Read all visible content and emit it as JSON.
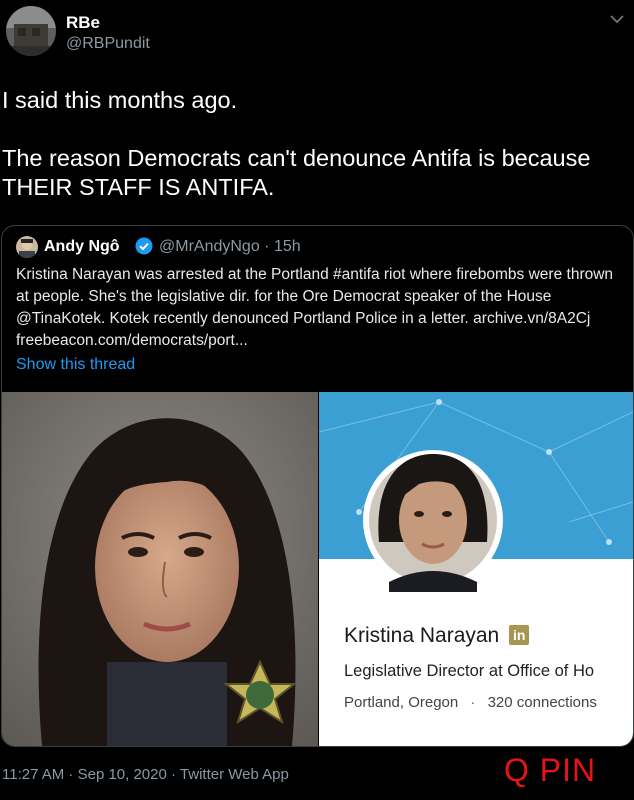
{
  "tweet": {
    "author_name": "RBe",
    "author_handle": "@RBPundit",
    "text": "I said this months ago.\n\nThe reason Democrats can't denounce Antifa is because THEIR STAFF IS ANTIFA.",
    "footer": "11:27 AM · Sep 10, 2020 · Twitter Web App"
  },
  "quoted": {
    "author_name": "Andy Ngô",
    "meta": "@MrAndyNgo · 15h",
    "text": "Kristina Narayan was arrested at the Portland #antifa riot where firebombs were thrown at people. She's the legislative dir. for the Ore Democrat speaker of the House @TinaKotek. Kotek recently denounced Portland Police in a letter. archive.vn/8A2Cj freebeacon.com/democrats/port...",
    "show_thread": "Show this thread"
  },
  "linkedin_card": {
    "name": "Kristina Narayan",
    "badge": "in",
    "title": "Legislative Director at Office of Ho",
    "location": "Portland, Oregon",
    "connections": "320 connections"
  },
  "watermark": "Q PIN",
  "colors": {
    "link": "#1d9bf0",
    "watermark": "#e81414",
    "verified": "#1d9bf0",
    "linkedin_bg": "#3b9fd4"
  },
  "icons": [
    "chevron-down-icon",
    "verified-badge-icon",
    "linkedin-icon",
    "police-star-icon"
  ]
}
